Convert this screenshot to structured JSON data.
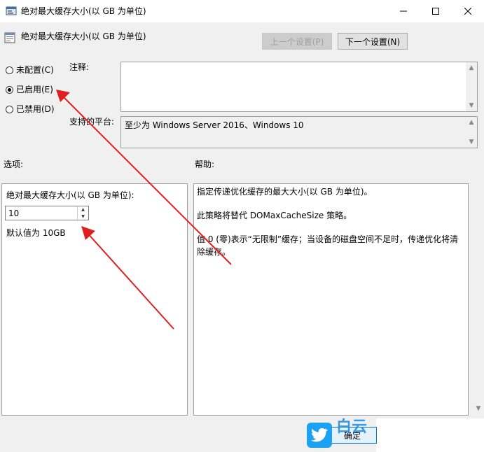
{
  "window": {
    "title": "绝对最大缓存大小(以 GB 为单位)",
    "icons": [
      "policy-icon",
      "minimize-icon",
      "maximize-icon",
      "close-icon"
    ]
  },
  "header": {
    "title": "绝对最大缓存大小(以 GB 为单位)",
    "prev_label": "上一个设置(P)",
    "next_label": "下一个设置(N)"
  },
  "state": {
    "options": [
      {
        "label": "未配置(C)",
        "selected": false
      },
      {
        "label": "已启用(E)",
        "selected": true
      },
      {
        "label": "已禁用(D)",
        "selected": false
      }
    ]
  },
  "comment": {
    "label": "注释:",
    "value": ""
  },
  "platform": {
    "label": "支持的平台:",
    "value": "至少为 Windows Server 2016、Windows 10"
  },
  "options_panel": {
    "label": "选项:",
    "field_label": "绝对最大缓存大小(以 GB 为单位):",
    "value": "10",
    "default_text": "默认值为 10GB"
  },
  "help_panel": {
    "label": "帮助:",
    "paragraphs": [
      "指定传递优化缓存的最大大小(以 GB 为单位)。",
      "此策略将替代 DOMaxCacheSize 策略。",
      "值 0 (零)表示“无限制”缓存；当设备的磁盘空间不足时，传递优化将清除缓存。"
    ]
  },
  "footer": {
    "ok_label": "确定",
    "watermark_text": "白云"
  },
  "colors": {
    "annotation_arrow": "#e02020",
    "accent": "#0078d7",
    "watermark": "#1da1f2"
  }
}
